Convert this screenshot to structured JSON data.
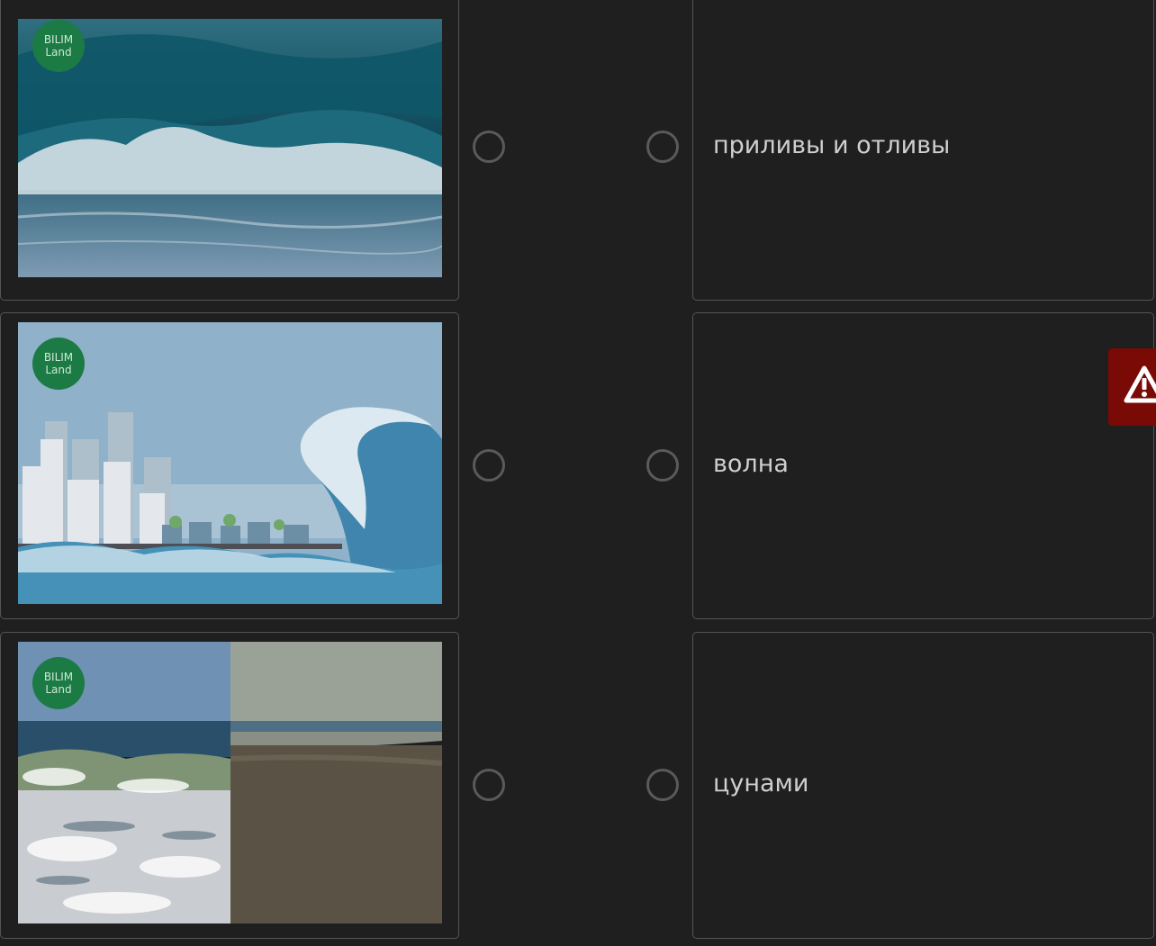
{
  "logo": {
    "line1": "BILIM",
    "line2": "Land"
  },
  "rows": [
    {
      "image_icon": "ocean-wave-photo",
      "answer": "приливы и отливы"
    },
    {
      "image_icon": "tsunami-city-illustration",
      "answer": "волна"
    },
    {
      "image_icon": "tide-high-low-photo",
      "answer": "цунами"
    }
  ],
  "alert": {
    "icon": "warning-icon",
    "color": "#7a0a06"
  }
}
